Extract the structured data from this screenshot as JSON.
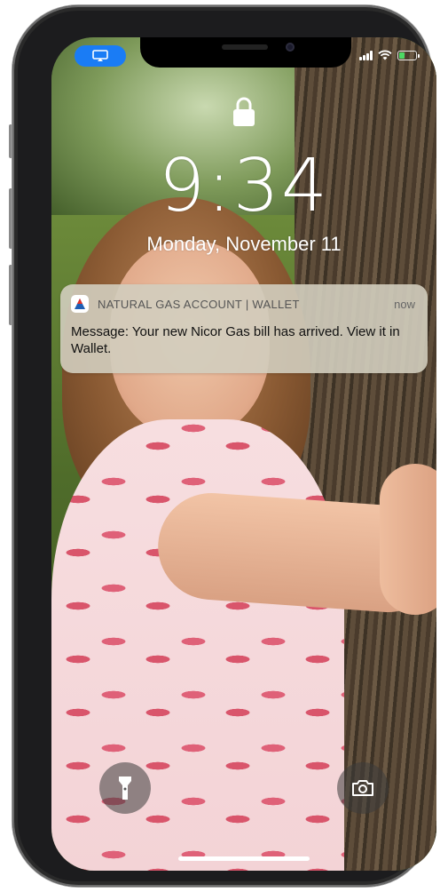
{
  "status_bar": {
    "screen_mirroring_icon": "screen-mirroring-icon",
    "signal_icon": "cellular-signal-icon",
    "wifi_icon": "wifi-icon",
    "battery_icon": "battery-charging-icon",
    "battery_level": 0.35,
    "battery_color": "#4cd964"
  },
  "lock": {
    "icon": "lock-icon",
    "time": "9:34",
    "date": "Monday, November 11"
  },
  "notification": {
    "app_icon": "natural-gas-app-icon",
    "app_name": "NATURAL GAS ACCOUNT | WALLET",
    "time": "now",
    "message": "Message: Your new Nicor Gas bill has arrived. View it in Wallet."
  },
  "quick_actions": {
    "left_icon": "flashlight-icon",
    "right_icon": "camera-icon"
  },
  "colors": {
    "accent": "#1a7cf5"
  }
}
